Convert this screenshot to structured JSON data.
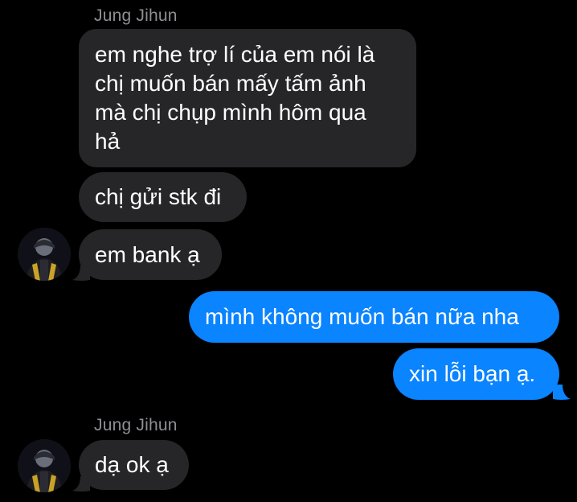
{
  "conversation": {
    "groups": [
      {
        "sender": "Jung Jihun"
      },
      {
        "sender": "Jung Jihun"
      }
    ],
    "messages": [
      {
        "direction": "incoming",
        "text": "em nghe trợ lí của em nói là\nchị muốn bán mấy tấm ảnh\nmà chị chụp mình hôm qua\nhả"
      },
      {
        "direction": "incoming",
        "text": "chị gửi stk đi"
      },
      {
        "direction": "incoming",
        "text": "em bank ạ"
      },
      {
        "direction": "outgoing",
        "text": "mình không muốn bán nữa nha"
      },
      {
        "direction": "outgoing",
        "text": "xin lỗi bạn ạ."
      },
      {
        "direction": "incoming",
        "text": "dạ ok ạ"
      }
    ]
  },
  "colors": {
    "background": "#000000",
    "incoming_bubble": "#262628",
    "outgoing_bubble": "#0a84ff",
    "sender_name": "#8e8e93",
    "text": "#ffffff"
  },
  "icons": {
    "avatar": "contact-avatar"
  }
}
